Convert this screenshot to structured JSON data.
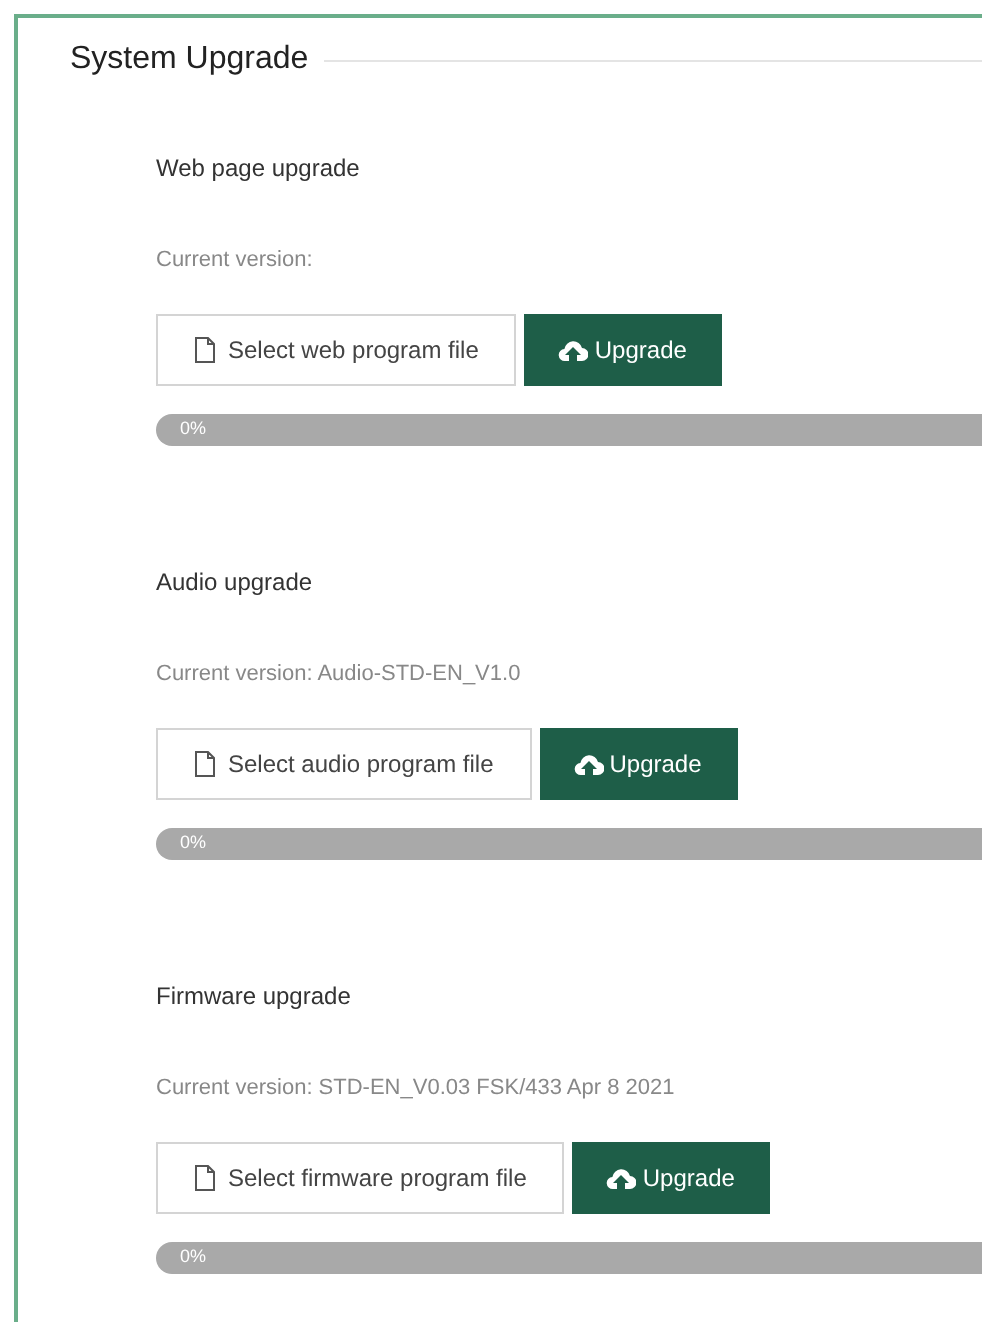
{
  "title": "System Upgrade",
  "sections": [
    {
      "heading": "Web page upgrade",
      "version": "Current version:",
      "select_button": "Select web program file",
      "upgrade_button": "Upgrade",
      "progress": {
        "level": 0,
        "label": "0%"
      }
    },
    {
      "heading": "Audio upgrade",
      "version": "Current version: Audio-STD-EN_V1.0",
      "select_button": "Select audio program file",
      "upgrade_button": "Upgrade",
      "progress": {
        "level": 0,
        "label": "0%"
      }
    },
    {
      "heading": "Firmware upgrade",
      "version": "Current version: STD-EN_V0.03 FSK/433 Apr 8 2021",
      "select_button": "Select firmware program file",
      "upgrade_button": "Upgrade",
      "progress": {
        "level": 0,
        "label": "0%"
      }
    }
  ]
}
